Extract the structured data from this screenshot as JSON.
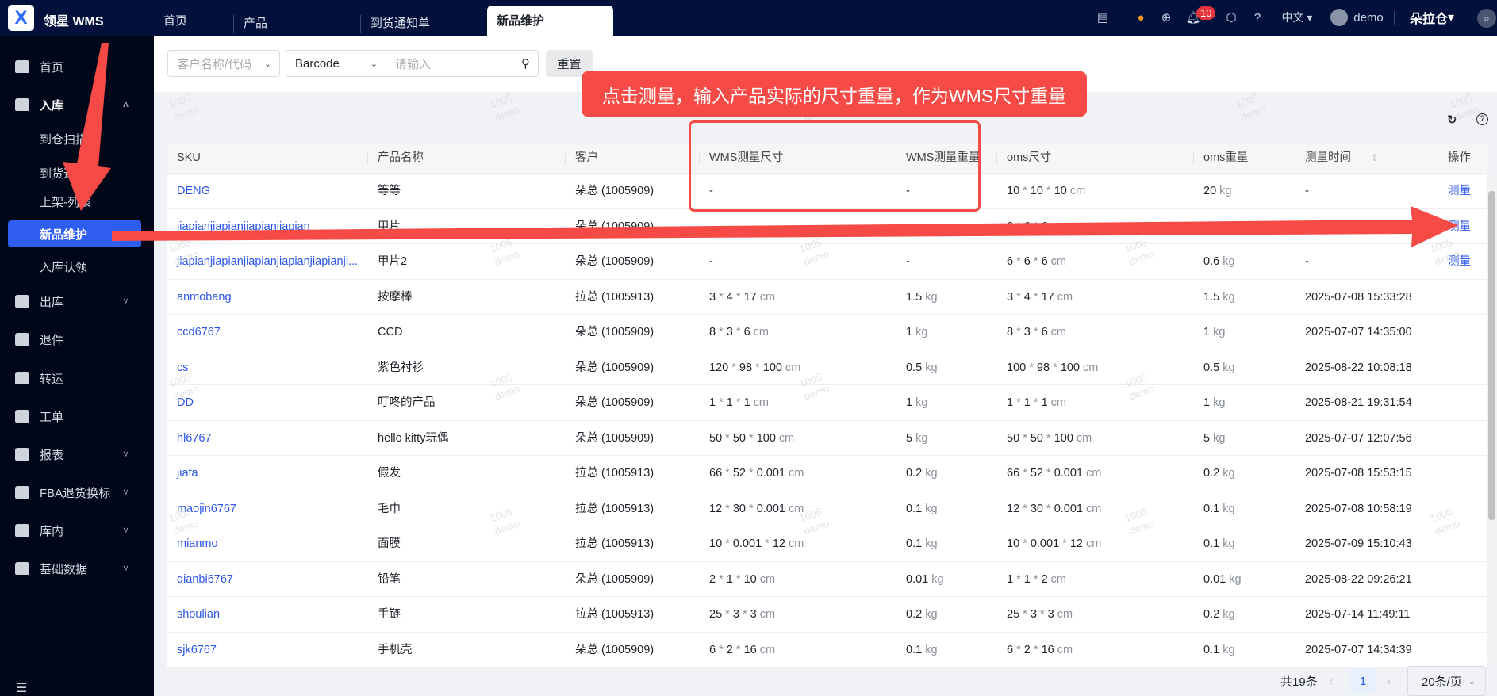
{
  "header": {
    "logo_glyph": "X",
    "brand": "领星 WMS",
    "tabs": [
      "首页",
      "产品",
      "到货通知单",
      "新品维护"
    ],
    "notification_count": "10",
    "language": "中文",
    "user": "demo",
    "warehouse": "朵拉仓"
  },
  "sidebar": {
    "items": [
      {
        "label": "首页",
        "type": "top"
      },
      {
        "label": "入库",
        "type": "top",
        "expanded": true
      },
      {
        "label": "到仓扫描",
        "type": "sub"
      },
      {
        "label": "到货通知单",
        "type": "sub"
      },
      {
        "label": "上架-列表",
        "type": "sub"
      },
      {
        "label": "新品维护",
        "type": "sub",
        "active": true
      },
      {
        "label": "入库认领",
        "type": "sub"
      },
      {
        "label": "出库",
        "type": "top",
        "chevron": true
      },
      {
        "label": "退件",
        "type": "top"
      },
      {
        "label": "转运",
        "type": "top"
      },
      {
        "label": "工单",
        "type": "top"
      },
      {
        "label": "报表",
        "type": "top",
        "chevron": true
      },
      {
        "label": "FBA退货换标",
        "type": "top",
        "chevron": true
      },
      {
        "label": "库内",
        "type": "top",
        "chevron": true
      },
      {
        "label": "基础数据",
        "type": "top",
        "chevron": true
      }
    ]
  },
  "filters": {
    "customer_placeholder": "客户名称/代码",
    "search_type": "Barcode",
    "search_placeholder": "请输入",
    "reset_label": "重置"
  },
  "annotation": {
    "tip": "点击测量，输入产品实际的尺寸重量，作为WMS尺寸重量"
  },
  "watermark": {
    "line1": "1005",
    "line2": "demo"
  },
  "table": {
    "columns": [
      "SKU",
      "产品名称",
      "客户",
      "WMS测量尺寸",
      "WMS测量重量",
      "oms尺寸",
      "oms重量",
      "测量时间",
      "操作"
    ],
    "unit_size": "cm",
    "unit_weight": "kg",
    "action_label": "测量",
    "rows": [
      {
        "sku": "DENG",
        "name": "等等",
        "customer": "朵总 (1005909)",
        "wms_size": null,
        "wms_weight": null,
        "oms_size": [
          "10",
          "10",
          "10"
        ],
        "oms_weight": "20",
        "time": "-",
        "action": true
      },
      {
        "sku": "jiapianjiapianjiapianjiapian",
        "name": "甲片",
        "customer": "朵总 (1005909)",
        "wms_size": null,
        "wms_weight": null,
        "oms_size": [
          "6",
          "6",
          "6"
        ],
        "oms_weight": "0.5",
        "time": "-",
        "action": true
      },
      {
        "sku": "jiapianjiapianjiapianjiapianjiapianji...",
        "name": "甲片2",
        "customer": "朵总 (1005909)",
        "wms_size": null,
        "wms_weight": null,
        "oms_size": [
          "6",
          "6",
          "6"
        ],
        "oms_weight": "0.6",
        "time": "-",
        "action": true
      },
      {
        "sku": "anmobang",
        "name": "按摩棒",
        "customer": "拉总 (1005913)",
        "wms_size": [
          "3",
          "4",
          "17"
        ],
        "wms_weight": "1.5",
        "oms_size": [
          "3",
          "4",
          "17"
        ],
        "oms_weight": "1.5",
        "time": "2025-07-08 15:33:28"
      },
      {
        "sku": "ccd6767",
        "name": "CCD",
        "customer": "朵总 (1005909)",
        "wms_size": [
          "8",
          "3",
          "6"
        ],
        "wms_weight": "1",
        "oms_size": [
          "8",
          "3",
          "6"
        ],
        "oms_weight": "1",
        "time": "2025-07-07 14:35:00"
      },
      {
        "sku": "cs",
        "name": "紫色衬衫",
        "customer": "朵总 (1005909)",
        "wms_size": [
          "120",
          "98",
          "100"
        ],
        "wms_weight": "0.5",
        "oms_size": [
          "100",
          "98",
          "100"
        ],
        "oms_weight": "0.5",
        "time": "2025-08-22 10:08:18"
      },
      {
        "sku": "DD",
        "name": "叮咚的产品",
        "customer": "朵总 (1005909)",
        "wms_size": [
          "1",
          "1",
          "1"
        ],
        "wms_weight": "1",
        "oms_size": [
          "1",
          "1",
          "1"
        ],
        "oms_weight": "1",
        "time": "2025-08-21 19:31:54"
      },
      {
        "sku": "hl6767",
        "name": "hello kitty玩偶",
        "customer": "朵总 (1005909)",
        "wms_size": [
          "50",
          "50",
          "100"
        ],
        "wms_weight": "5",
        "oms_size": [
          "50",
          "50",
          "100"
        ],
        "oms_weight": "5",
        "time": "2025-07-07 12:07:56"
      },
      {
        "sku": "jiafa",
        "name": "假发",
        "customer": "拉总 (1005913)",
        "wms_size": [
          "66",
          "52",
          "0.001"
        ],
        "wms_weight": "0.2",
        "oms_size": [
          "66",
          "52",
          "0.001"
        ],
        "oms_weight": "0.2",
        "time": "2025-07-08 15:53:15"
      },
      {
        "sku": "maojin6767",
        "name": "毛巾",
        "customer": "拉总 (1005913)",
        "wms_size": [
          "12",
          "30",
          "0.001"
        ],
        "wms_weight": "0.1",
        "oms_size": [
          "12",
          "30",
          "0.001"
        ],
        "oms_weight": "0.1",
        "time": "2025-07-08 10:58:19"
      },
      {
        "sku": "mianmo",
        "name": "面膜",
        "customer": "拉总 (1005913)",
        "wms_size": [
          "10",
          "0.001",
          "12"
        ],
        "wms_weight": "0.1",
        "oms_size": [
          "10",
          "0.001",
          "12"
        ],
        "oms_weight": "0.1",
        "time": "2025-07-09 15:10:43"
      },
      {
        "sku": "qianbi6767",
        "name": "铅笔",
        "customer": "朵总 (1005909)",
        "wms_size": [
          "2",
          "1",
          "10"
        ],
        "wms_weight": "0.01",
        "oms_size": [
          "1",
          "1",
          "2"
        ],
        "oms_weight": "0.01",
        "time": "2025-08-22 09:26:21"
      },
      {
        "sku": "shoulian",
        "name": "手链",
        "customer": "拉总 (1005913)",
        "wms_size": [
          "25",
          "3",
          "3"
        ],
        "wms_weight": "0.2",
        "oms_size": [
          "25",
          "3",
          "3"
        ],
        "oms_weight": "0.2",
        "time": "2025-07-14 11:49:11"
      },
      {
        "sku": "sjk6767",
        "name": "手机壳",
        "customer": "朵总 (1005909)",
        "wms_size": [
          "6",
          "2",
          "16"
        ],
        "wms_weight": "0.1",
        "oms_size": [
          "6",
          "2",
          "16"
        ],
        "oms_weight": "0.1",
        "time": "2025-07-07 14:34:39"
      }
    ]
  },
  "pagination": {
    "total": "共19条",
    "current_page": "1",
    "page_size": "20条/页"
  },
  "colors": {
    "accent": "#2f5ef0",
    "annotation": "#f54a45",
    "topbar": "#02113b"
  }
}
